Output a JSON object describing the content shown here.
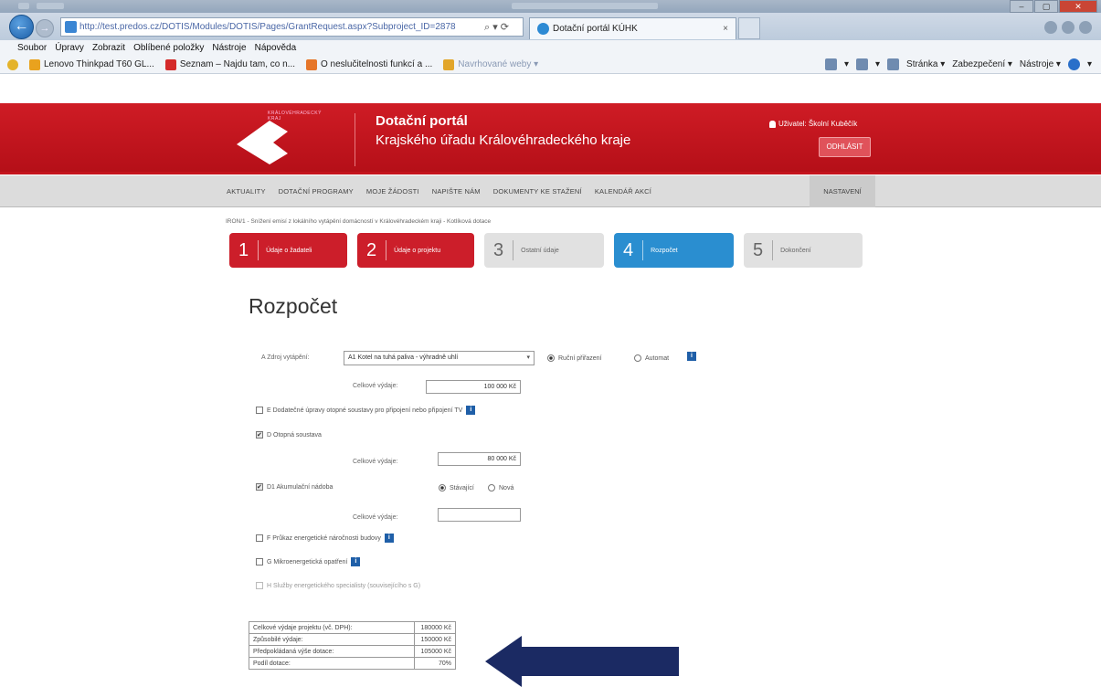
{
  "browser": {
    "url": "http://test.predos.cz/DOTIS/Modules/DOTIS/Pages/GrantRequest.aspx?Subproject_ID=2878",
    "url_tools": "⌕ ▾ ⟳",
    "tab_title": "Dotační portál KÚHK",
    "tab_close": "×",
    "min": "–",
    "max": "▢",
    "close": "✕",
    "menu": [
      "Soubor",
      "Úpravy",
      "Zobrazit",
      "Oblíbené položky",
      "Nástroje",
      "Nápověda"
    ],
    "favorites": [
      {
        "label": "Lenovo Thinkpad T60 GL...",
        "color": "#e9a21e"
      },
      {
        "label": "Seznam – Najdu tam, co n...",
        "color": "#d42a2a"
      },
      {
        "label": "O neslučitelnosti funkcí a ...",
        "color": "#e6762a"
      },
      {
        "label": "Navrhované weby ▾",
        "color": "#e2a62b"
      }
    ],
    "commands": [
      "▾",
      "▾",
      "Stránka ▾",
      "Zabezpečení ▾",
      "Nástroje ▾",
      "▾"
    ]
  },
  "header": {
    "logo_text": "KRÁLOVÉHRADECKÝ KRAJ",
    "title": "Dotační portál",
    "subtitle": "Krajského úřadu Královéhradeckého kraje",
    "user": "Uživatel: Školní Kuběčík",
    "logout": "ODHLÁSIT",
    "brand_color": "#c4141d"
  },
  "nav": {
    "items": [
      "AKTUALITY",
      "DOTAČNÍ PROGRAMY",
      "MOJE ŽÁDOSTI",
      "NAPIŠTE NÁM",
      "DOKUMENTY KE STAŽENÍ",
      "KALENDÁŘ AKCÍ"
    ],
    "settings": "NASTAVENÍ"
  },
  "breadcrumb": "IRON/1 - Snížení emisí z lokálního vytápění domácností v Královéhradeckém kraji - Kotlíková dotace",
  "steps": [
    {
      "num": "1",
      "label": "Údaje o žadateli",
      "state": "done"
    },
    {
      "num": "2",
      "label": "Údaje o projektu",
      "state": "done"
    },
    {
      "num": "3",
      "label": "Ostatní údaje",
      "state": "todo"
    },
    {
      "num": "4",
      "label": "Rozpočet",
      "state": "active"
    },
    {
      "num": "5",
      "label": "Dokončení",
      "state": "todo"
    }
  ],
  "page_title": "Rozpočet",
  "form": {
    "a_label": "A Zdroj vytápění:",
    "a_select": "A1 Kotel na tuhá paliva - výhradně uhlí",
    "a_select_arrow": "▾",
    "a_radio_manual": "Ruční přiřazení",
    "a_radio_auto": "Automat",
    "a_cost_label": "Celkové výdaje:",
    "a_cost_value": "100 000 Kč",
    "e_label": "E Dodatečné úpravy otopné soustavy pro připojení nebo připojení TV",
    "d_label": "D Otopná soustava",
    "d_cost_label": "Celkové výdaje:",
    "d_cost_value": "80 000 Kč",
    "d1_label": "D1 Akumulační nádoba",
    "d1_radio_existing": "Stávající",
    "d1_radio_new": "Nová",
    "d1_cost_label": "Celkové výdaje:",
    "d1_cost_value": "",
    "f_label": "F Průkaz energetické náročnosti budovy",
    "g_label": "G Mikroenergetická opatření",
    "h_label": "H Služby energetického specialisty (souvisejícího s G)",
    "info_glyph": "i"
  },
  "summary": [
    {
      "label": "Celkové výdaje projektu (vč. DPH):",
      "value": "180000 Kč"
    },
    {
      "label": "Způsobilé výdaje:",
      "value": "150000 Kč"
    },
    {
      "label": "Předpokládaná výše dotace:",
      "value": "105000 Kč"
    },
    {
      "label": "Podíl dotace:",
      "value": "70%"
    }
  ],
  "annotation_arrow_color": "#1b2a63"
}
